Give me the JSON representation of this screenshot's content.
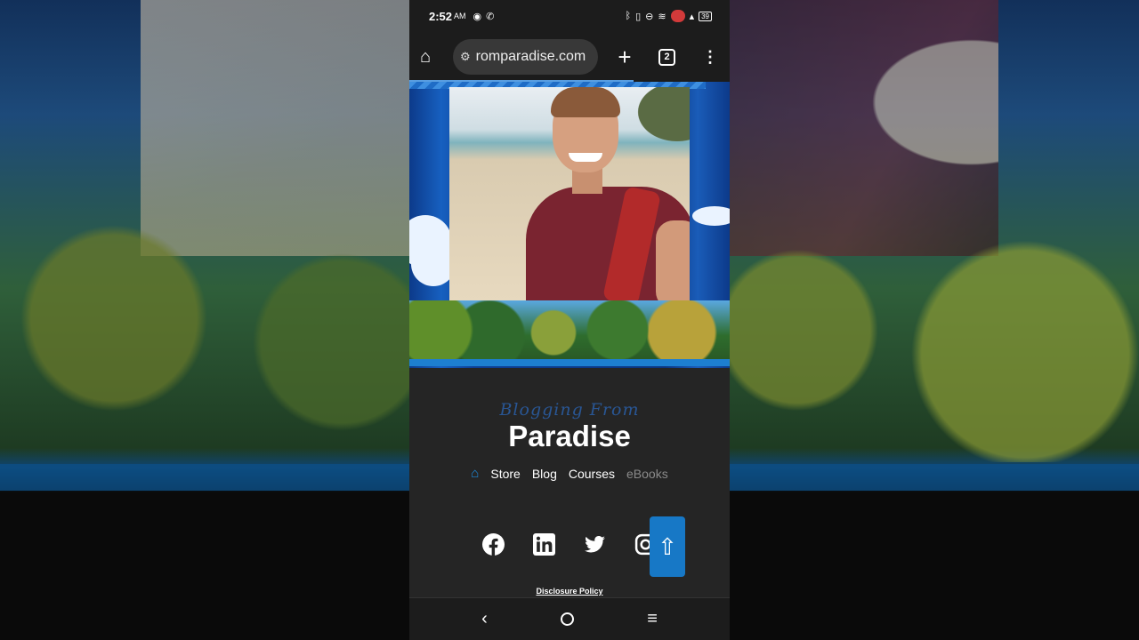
{
  "statusbar": {
    "time": "2:52",
    "ampm": "AM",
    "battery": "39"
  },
  "browser": {
    "url": "romparadise.com",
    "tab_count": "2"
  },
  "site": {
    "tagline": "Blogging From",
    "brand": "Paradise",
    "nav": {
      "store": "Store",
      "blog": "Blog",
      "courses": "Courses",
      "ebooks": "eBooks"
    },
    "disclosure": "Disclosure Policy",
    "social": [
      "facebook-icon",
      "linkedin-icon",
      "twitter-icon",
      "instagram-icon"
    ]
  },
  "colors": {
    "accent": "#1778c6",
    "nav_home": "#1d8ce0",
    "footer_bg": "#252525"
  }
}
